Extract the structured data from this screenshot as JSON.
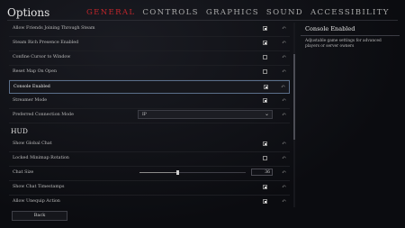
{
  "header": {
    "title": "Options",
    "tabs": [
      {
        "label": "GENERAL",
        "active": true
      },
      {
        "label": "CONTROLS",
        "active": false
      },
      {
        "label": "GRAPHICS",
        "active": false
      },
      {
        "label": "SOUND",
        "active": false
      },
      {
        "label": "ACCESSIBILITY",
        "active": false
      }
    ]
  },
  "settings": {
    "rows": [
      {
        "label": "Allow Friends Joining Through Steam",
        "checked": true
      },
      {
        "label": "Steam Rich Presence Enabled",
        "checked": true
      },
      {
        "label": "Confine Cursor to Window",
        "checked": false
      },
      {
        "label": "Reset Map On Open",
        "checked": false
      },
      {
        "label": "Console Enabled",
        "checked": true
      },
      {
        "label": "Streamer Mode",
        "checked": true
      },
      {
        "label": "Preferred Connection Mode",
        "value": "IP"
      }
    ],
    "hud_section": "HUD",
    "hud_rows": [
      {
        "label": "Show Global Chat",
        "checked": true
      },
      {
        "label": "Locked Minimap Rotation",
        "checked": false
      },
      {
        "label": "Chat Size",
        "value": "36",
        "fraction": 0.36
      },
      {
        "label": "Show Chat Timestamps",
        "checked": true
      },
      {
        "label": "Allow Unequip Action",
        "checked": true
      }
    ],
    "reset_symbol": "↶",
    "dropdown_symbol": "⌄"
  },
  "description": {
    "title": "Console Enabled",
    "body": "Adjustable game settings for advanced players or server owners"
  },
  "footer": {
    "back_label": "Back",
    "version": ""
  },
  "colors": {
    "accent": "#c0252b",
    "selected_border": "#5b6f8a"
  }
}
